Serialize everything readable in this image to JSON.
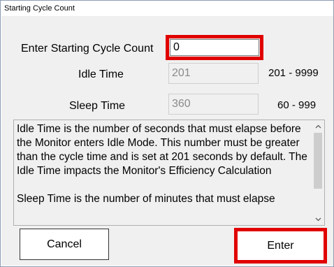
{
  "window": {
    "title": "Starting Cycle Count"
  },
  "form": {
    "cycle_label": "Enter Starting Cycle Count",
    "cycle_value": "0",
    "idle_label": "Idle Time",
    "idle_value": "201",
    "idle_range": "201 - 9999",
    "sleep_label": "Sleep Time",
    "sleep_value": "360",
    "sleep_range": "60 - 999"
  },
  "description": {
    "paragraph1": "Idle Time is the number of seconds that must elapse before the Monitor enters Idle Mode. This number must be greater than the cycle time and is set at 201 seconds by default. The Idle Time impacts the Monitor's Efficiency Calculation",
    "paragraph2": "Sleep Time is the number of minutes that must elapse"
  },
  "buttons": {
    "cancel_label": "Cancel",
    "enter_label": "Enter"
  },
  "colors": {
    "highlight": "#e10000",
    "dialog_background": "#f0f0f0"
  },
  "icons": {
    "scroll_up": "chevron-up-icon",
    "scroll_down": "chevron-down-icon"
  }
}
